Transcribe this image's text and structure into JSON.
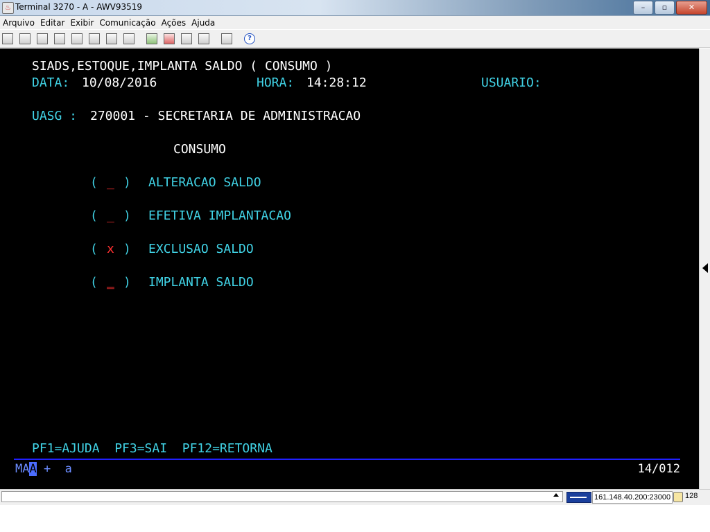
{
  "window": {
    "title": "Terminal 3270 - A - AWV93519",
    "buttons": {
      "minimize": "–",
      "maximize": "▫",
      "close": "✕"
    }
  },
  "menu": [
    "Arquivo",
    "Editar",
    "Exibir",
    "Comunicação",
    "Ações",
    "Ajuda"
  ],
  "toolbar": {
    "icons": [
      "print-screen-icon",
      "print-icon",
      "print-setup-icon",
      "copy-icon",
      "paste-icon",
      "copy-append-icon",
      "macro-icon",
      "keypad-icon",
      "send-file-icon",
      "receive-file-icon",
      "connect-icon",
      "disconnect-icon",
      "settings-icon",
      "help-icon"
    ],
    "help_glyph": "?"
  },
  "screen": {
    "header_title": "SIADS,ESTOQUE,IMPLANTA SALDO ( CONSUMO )",
    "data_label": "DATA:",
    "data_value": "10/08/2016",
    "hora_label": "HORA:",
    "hora_value": "14:28:12",
    "usuario_label": "USUARIO:",
    "uasg_label": "UASG :",
    "uasg_value": "270001 - SECRETARIA DE ADMINISTRACAO",
    "section_title": "CONSUMO",
    "options": [
      {
        "mark": "_",
        "label": "ALTERACAO SALDO"
      },
      {
        "mark": "_",
        "label": "EFETIVA IMPLANTACAO"
      },
      {
        "mark": "x",
        "label": "EXCLUSAO SALDO"
      },
      {
        "mark": "_",
        "label": "IMPLANTA SALDO"
      }
    ],
    "bracket_open": "(",
    "bracket_close": ")",
    "function_keys": "PF1=AJUDA  PF3=SAI  PF12=RETORNA",
    "oia_left": "MA",
    "oia_cursor": "A",
    "oia_right": " +  a",
    "cursor_position": "14/012"
  },
  "statusbar": {
    "host": "161.148.40.200:23000",
    "encryption_bits": "128"
  },
  "colors": {
    "screen_bg": "#000000",
    "field_cyan": "#41d3e6",
    "input_red": "#ff3030",
    "oia_blue": "#6b8cff"
  }
}
